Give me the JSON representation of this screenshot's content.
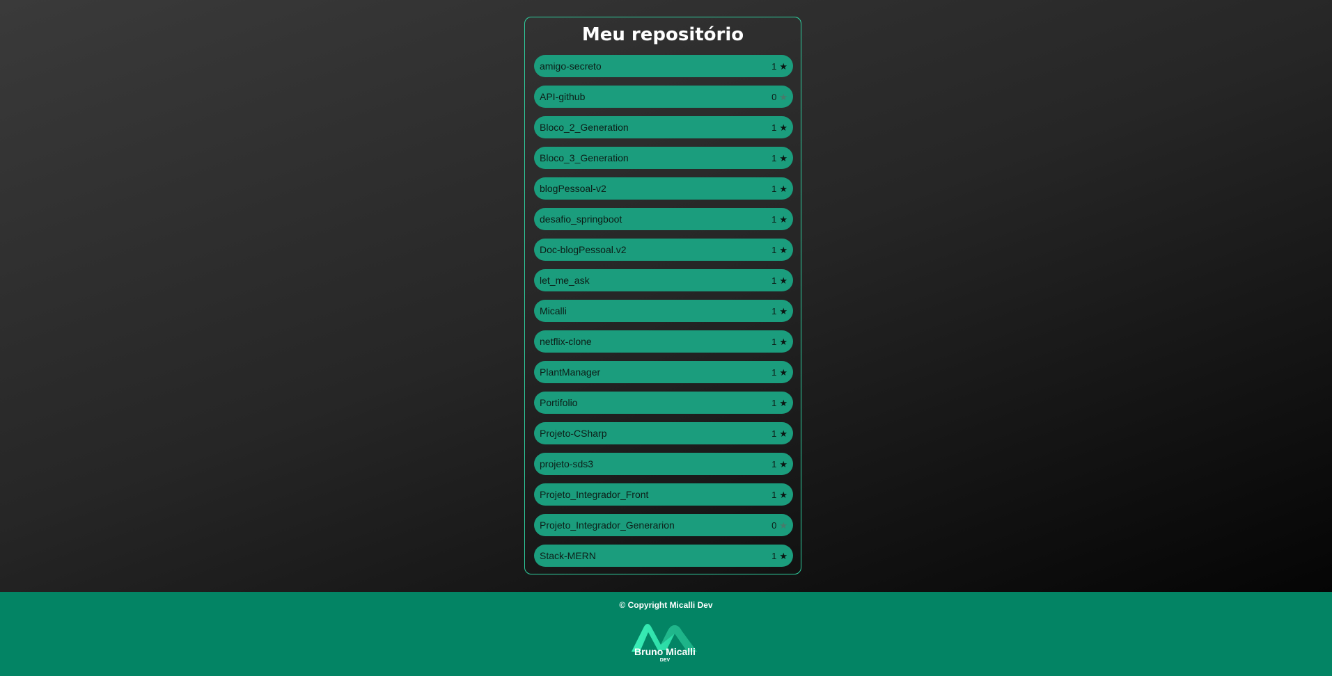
{
  "page": {
    "title": "Meu repositório"
  },
  "repos": [
    {
      "name": "amigo-secreto",
      "stars": "1",
      "starred": true
    },
    {
      "name": "API-github",
      "stars": "0",
      "starred": false
    },
    {
      "name": "Bloco_2_Generation",
      "stars": "1",
      "starred": true
    },
    {
      "name": "Bloco_3_Generation",
      "stars": "1",
      "starred": true
    },
    {
      "name": "blogPessoal-v2",
      "stars": "1",
      "starred": true
    },
    {
      "name": "desafio_springboot",
      "stars": "1",
      "starred": true
    },
    {
      "name": "Doc-blogPessoal.v2",
      "stars": "1",
      "starred": true
    },
    {
      "name": "let_me_ask",
      "stars": "1",
      "starred": true
    },
    {
      "name": "Micalli",
      "stars": "1",
      "starred": true
    },
    {
      "name": "netflix-clone",
      "stars": "1",
      "starred": true
    },
    {
      "name": "PlantManager",
      "stars": "1",
      "starred": true
    },
    {
      "name": "Portifolio",
      "stars": "1",
      "starred": true
    },
    {
      "name": "Projeto-CSharp",
      "stars": "1",
      "starred": true
    },
    {
      "name": "projeto-sds3",
      "stars": "1",
      "starred": true
    },
    {
      "name": "Projeto_Integrador_Front",
      "stars": "1",
      "starred": true
    },
    {
      "name": "Projeto_Integrador_Generarion",
      "stars": "0",
      "starred": false
    },
    {
      "name": "Stack-MERN",
      "stars": "1",
      "starred": true
    }
  ],
  "footer": {
    "copyright_prefix": "© Copyright ",
    "copyright_brand": "Micalli Dev",
    "logo_name": "Bruno Micalli",
    "logo_sub": "DEV"
  },
  "icons": {
    "star": "star-icon"
  },
  "colors": {
    "accent": "#2fd1a0",
    "item_bg": "#1b9d7d",
    "footer_bg": "#038464"
  }
}
